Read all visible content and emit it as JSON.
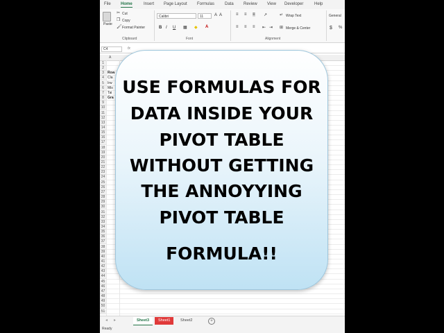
{
  "ribbon": {
    "tabs": [
      "File",
      "Home",
      "Insert",
      "Page Layout",
      "Formulas",
      "Data",
      "Review",
      "View",
      "Developer",
      "Help"
    ],
    "active_tab": "Home",
    "clipboard": {
      "paste": "Paste",
      "cut": "Cut",
      "copy": "Copy",
      "format_painter": "Format Painter",
      "label": "Clipboard"
    },
    "font": {
      "name": "Calibri",
      "size": "11",
      "bold": "B",
      "italic": "I",
      "underline": "U",
      "label": "Font"
    },
    "alignment": {
      "wrap_text": "Wrap Text",
      "merge_center": "Merge & Center",
      "label": "Alignment"
    },
    "number": {
      "format": "General",
      "currency": "$"
    }
  },
  "formula_bar": {
    "name_box": "C4",
    "fx": "fx"
  },
  "grid": {
    "col_a": "A",
    "row_numbers": [
      "1",
      "2",
      "3",
      "4",
      "5",
      "6",
      "7",
      "8",
      "9",
      "10",
      "11",
      "12",
      "13",
      "14",
      "15",
      "16",
      "17",
      "18",
      "19",
      "20",
      "21",
      "22",
      "23",
      "24",
      "25",
      "26",
      "27",
      "28",
      "29",
      "30",
      "31",
      "32",
      "33",
      "34",
      "35",
      "36",
      "37",
      "38",
      "39",
      "40",
      "41",
      "42",
      "43",
      "44",
      "45",
      "46",
      "47",
      "48",
      "49",
      "50",
      "51",
      "52"
    ],
    "cells": [
      {
        "row": 3,
        "text": "Row",
        "bold": true
      },
      {
        "row": 4,
        "text": "Cla",
        "bold": false
      },
      {
        "row": 5,
        "text": "Irw",
        "bold": false
      },
      {
        "row": 6,
        "text": "Mis",
        "bold": false
      },
      {
        "row": 7,
        "text": "Tai",
        "bold": false
      },
      {
        "row": 8,
        "text": "Gra",
        "bold": true
      }
    ]
  },
  "sheets": [
    {
      "name": "Sheet3",
      "state": "active"
    },
    {
      "name": "Sheet1",
      "state": "red"
    },
    {
      "name": "Sheet2",
      "state": "normal"
    }
  ],
  "add_sheet": "+",
  "status": "Ready",
  "callout": {
    "lines": [
      "USE FORMULAS FOR",
      "DATA INSIDE YOUR",
      "PIVOT TABLE",
      "WITHOUT GETTING",
      "THE ANNOYYING",
      "PIVOT TABLE",
      "FORMULA!!"
    ]
  },
  "colors": {
    "accent": "#217346",
    "red_tab": "#e03a3a",
    "callout_border": "#9ec6dc"
  }
}
